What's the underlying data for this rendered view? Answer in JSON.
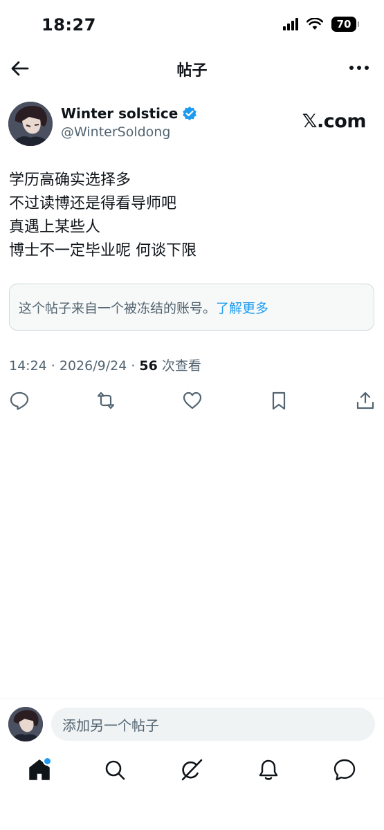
{
  "status_bar": {
    "time": "18:27",
    "battery": "70"
  },
  "nav": {
    "title": "帖子"
  },
  "post": {
    "author_name": "Winter solstice",
    "author_handle": "@WinterSoldong",
    "source": "𝕏.com",
    "lines": [
      "学历高确实选择多",
      "不过读博还是得看导师吧",
      "真遇上某些人",
      "博士不一定毕业呢 何谈下限"
    ],
    "notice_text": "这个帖子来自一个被冻结的账号。",
    "notice_link": "了解更多",
    "timestamp": "14:24 · 2026/9/24 · ",
    "views_count": "56",
    "views_label": " 次查看"
  },
  "reply": {
    "placeholder": "添加另一个帖子"
  },
  "colors": {
    "accent": "#1d9bf0",
    "secondary_text": "#536471",
    "primary_text": "#0f1419"
  },
  "icons": {
    "actions": [
      "reply-icon",
      "repost-icon",
      "like-icon",
      "bookmark-icon",
      "share-icon"
    ],
    "tabs": [
      "home-icon",
      "search-icon",
      "grok-icon",
      "notifications-icon",
      "messages-icon"
    ]
  }
}
